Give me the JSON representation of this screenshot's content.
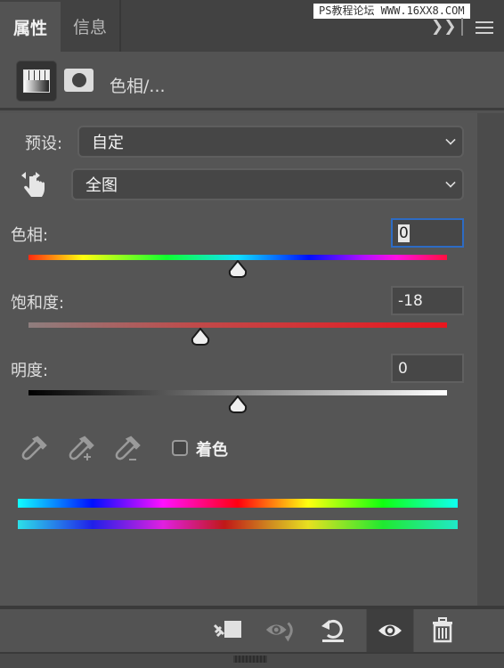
{
  "tabs": [
    {
      "label": "属性",
      "active": true
    },
    {
      "label": "信息",
      "active": false
    }
  ],
  "watermark": "PS教程论坛 WWW.16XX8.COM",
  "panel_icons": {
    "expand": "double-chevron-right-icon",
    "menu": "hamburger-menu-icon"
  },
  "adjustment": {
    "title": "色相/...",
    "icon": "hue-saturation-adjustment-icon",
    "mask_icon": "layer-mask-icon"
  },
  "preset": {
    "label": "预设:",
    "value": "自定"
  },
  "channel": {
    "value": "全图",
    "tool_icon": "targeted-adjustment-hand-icon"
  },
  "sliders": [
    {
      "label": "色相:",
      "value": "0",
      "min": -180,
      "max": 180,
      "numeric": 0,
      "focused": true
    },
    {
      "label": "饱和度:",
      "value": "-18",
      "min": -100,
      "max": 100,
      "numeric": -18,
      "focused": false
    },
    {
      "label": "明度:",
      "value": "0",
      "min": -100,
      "max": 100,
      "numeric": 0,
      "focused": false
    }
  ],
  "eyedroppers": [
    "eyedropper-icon",
    "eyedropper-add-icon",
    "eyedropper-subtract-icon"
  ],
  "colorize": {
    "label": "着色",
    "checked": false
  },
  "colors": {
    "focus_border": "#2d6bc4",
    "panel_bg": "#535353",
    "saturation_end": "#e8161e"
  },
  "footer_buttons": [
    {
      "name": "clip-to-layer-button",
      "icon": "clip-to-layer-icon"
    },
    {
      "name": "view-previous-state-button",
      "icon": "eye-cycle-icon"
    },
    {
      "name": "reset-button",
      "icon": "reset-icon"
    },
    {
      "name": "toggle-visibility-button",
      "icon": "eye-icon",
      "active": true
    },
    {
      "name": "delete-button",
      "icon": "trash-icon"
    }
  ]
}
